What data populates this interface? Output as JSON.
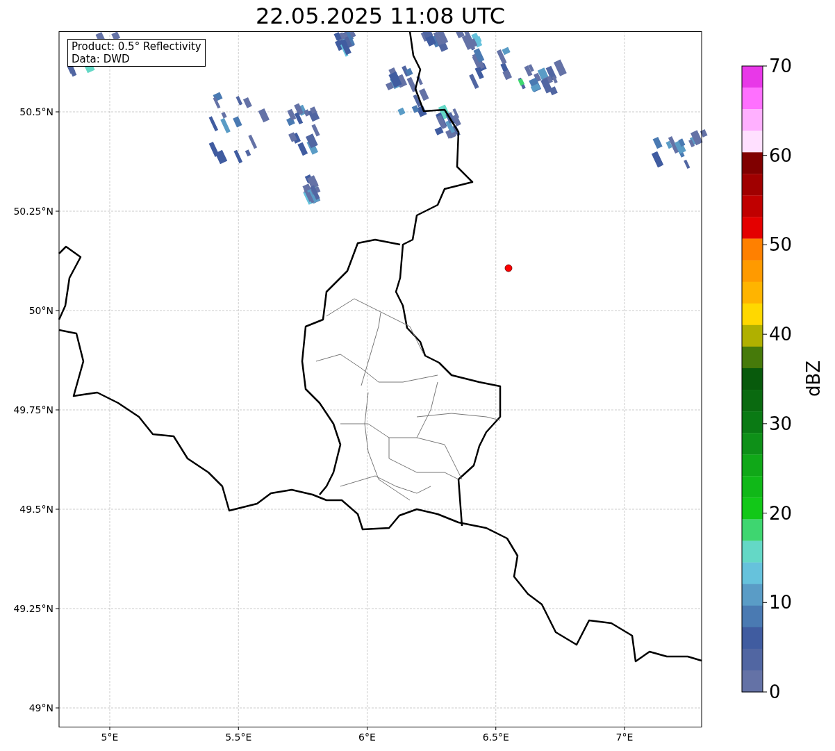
{
  "title": "22.05.2025 11:08 UTC",
  "map": {
    "info_box": [
      "Product: 0.5° Reflectivity",
      "Data: DWD"
    ],
    "y_ticks": [
      {
        "label": "50.5°N"
      },
      {
        "label": "50.25°N"
      },
      {
        "label": "50°N"
      },
      {
        "label": "49.75°N"
      },
      {
        "label": "49.5°N"
      },
      {
        "label": "49.25°N"
      },
      {
        "label": "49°N"
      }
    ],
    "x_ticks": [
      {
        "label": "5°E"
      },
      {
        "label": "5.5°E"
      },
      {
        "label": "6°E"
      },
      {
        "label": "6.5°E"
      },
      {
        "label": "7°E"
      }
    ]
  },
  "colorbar": {
    "label": "dBZ",
    "segments": [
      {
        "color": "#e838e8"
      },
      {
        "color": "#ff70ff"
      },
      {
        "color": "#ffb0ff"
      },
      {
        "color": "#ffe0ff"
      },
      {
        "color": "#800000"
      },
      {
        "color": "#a00000"
      },
      {
        "color": "#c00000"
      },
      {
        "color": "#e40000"
      },
      {
        "color": "#ff8000"
      },
      {
        "color": "#ff9a00"
      },
      {
        "color": "#ffb400"
      },
      {
        "color": "#ffd800"
      },
      {
        "color": "#b0b000"
      },
      {
        "color": "#467a0a"
      },
      {
        "color": "#085a0c"
      },
      {
        "color": "#0a6a10"
      },
      {
        "color": "#0a7a14"
      },
      {
        "color": "#0e9018"
      },
      {
        "color": "#10a818"
      },
      {
        "color": "#10b818"
      },
      {
        "color": "#12c818"
      },
      {
        "color": "#3ed670"
      },
      {
        "color": "#64d8c6"
      },
      {
        "color": "#66c2dc"
      },
      {
        "color": "#5a9cc6"
      },
      {
        "color": "#4a7ab2"
      },
      {
        "color": "#405ca0"
      },
      {
        "color": "#5166a2"
      },
      {
        "color": "#6472a6"
      }
    ],
    "ticks": [
      {
        "label": "70"
      },
      {
        "label": "60"
      },
      {
        "label": "50"
      },
      {
        "label": "40"
      },
      {
        "label": "30"
      },
      {
        "label": "20"
      },
      {
        "label": "10"
      },
      {
        "label": "0"
      }
    ]
  }
}
